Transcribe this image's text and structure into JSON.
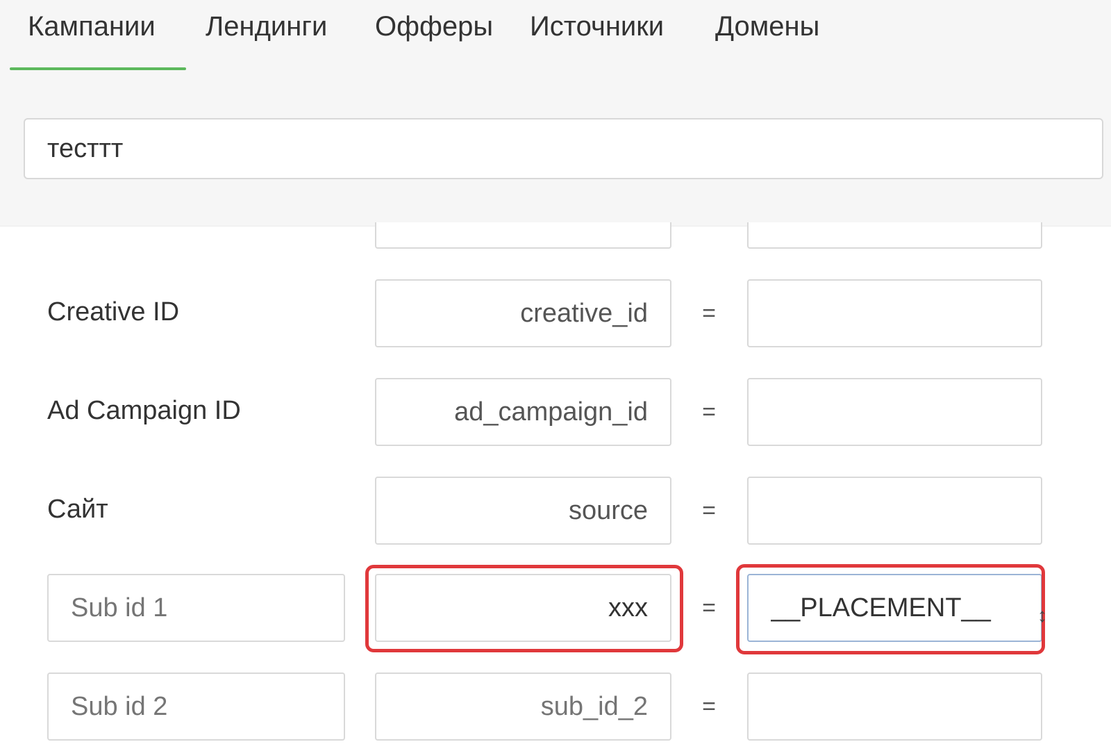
{
  "tabs": [
    {
      "label": "Кампании",
      "active": true
    },
    {
      "label": "Лендинги",
      "active": false
    },
    {
      "label": "Офферы",
      "active": false
    },
    {
      "label": "Источники",
      "active": false
    },
    {
      "label": "Домены",
      "active": false
    }
  ],
  "search": {
    "value": "тесттт"
  },
  "rows": {
    "creative": {
      "label": "Creative ID",
      "param": "creative_id",
      "eq": "=",
      "value": ""
    },
    "ad_campaign": {
      "label": "Ad Campaign ID",
      "param": "ad_campaign_id",
      "eq": "=",
      "value": ""
    },
    "site": {
      "label": "Сайт",
      "param": "source",
      "eq": "=",
      "value": ""
    },
    "sub1": {
      "name_placeholder": "Sub id 1",
      "param": "xxx",
      "eq": "=",
      "value": "__PLACEMENT__"
    },
    "sub2": {
      "name_placeholder": "Sub id 2",
      "param": "sub_id_2",
      "eq": "=",
      "value": ""
    }
  },
  "colors": {
    "active_tab_underline": "#5cb85c",
    "highlight": "#e0383b",
    "focus_border": "#9bb4d6"
  }
}
